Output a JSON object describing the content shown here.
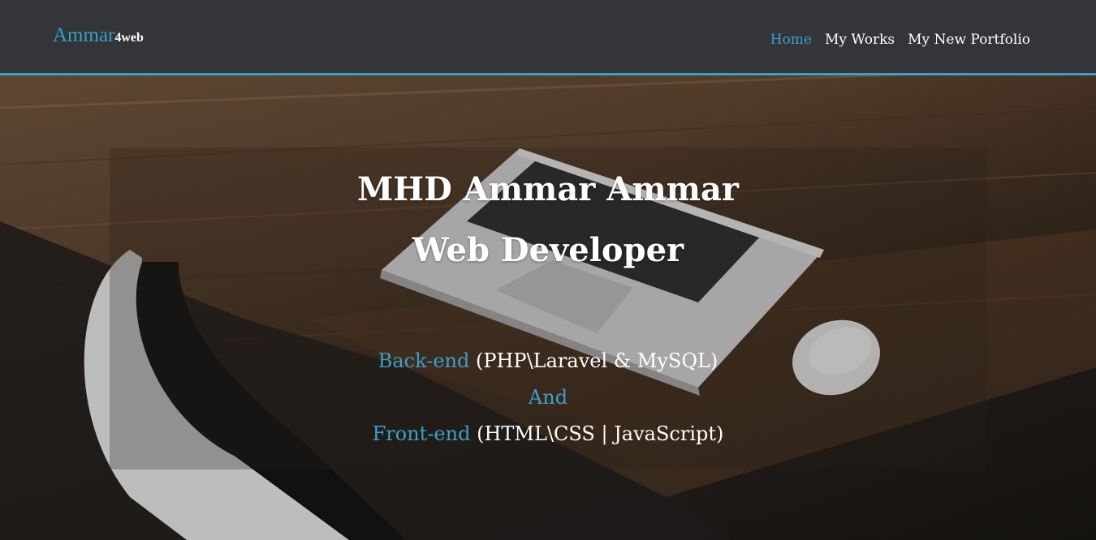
{
  "navbar": {
    "brand_main": "Ammar",
    "brand_sub": "4web",
    "links": [
      {
        "label": "Home",
        "active": true
      },
      {
        "label": "My Works",
        "active": false
      },
      {
        "label": "My New Portfolio",
        "active": false
      }
    ]
  },
  "hero": {
    "name": "MHD Ammar Ammar",
    "role": "Web Developer",
    "backend_label": "Back-end",
    "backend_detail": "(PHP\\Laravel & MySQL)",
    "connector": "And",
    "frontend_label": "Front-end",
    "frontend_detail": "(HTML\\CSS | JavaScript)"
  },
  "colors": {
    "accent": "#3aa0c8",
    "navbar_bg": "#333538",
    "text": "#ffffff"
  }
}
